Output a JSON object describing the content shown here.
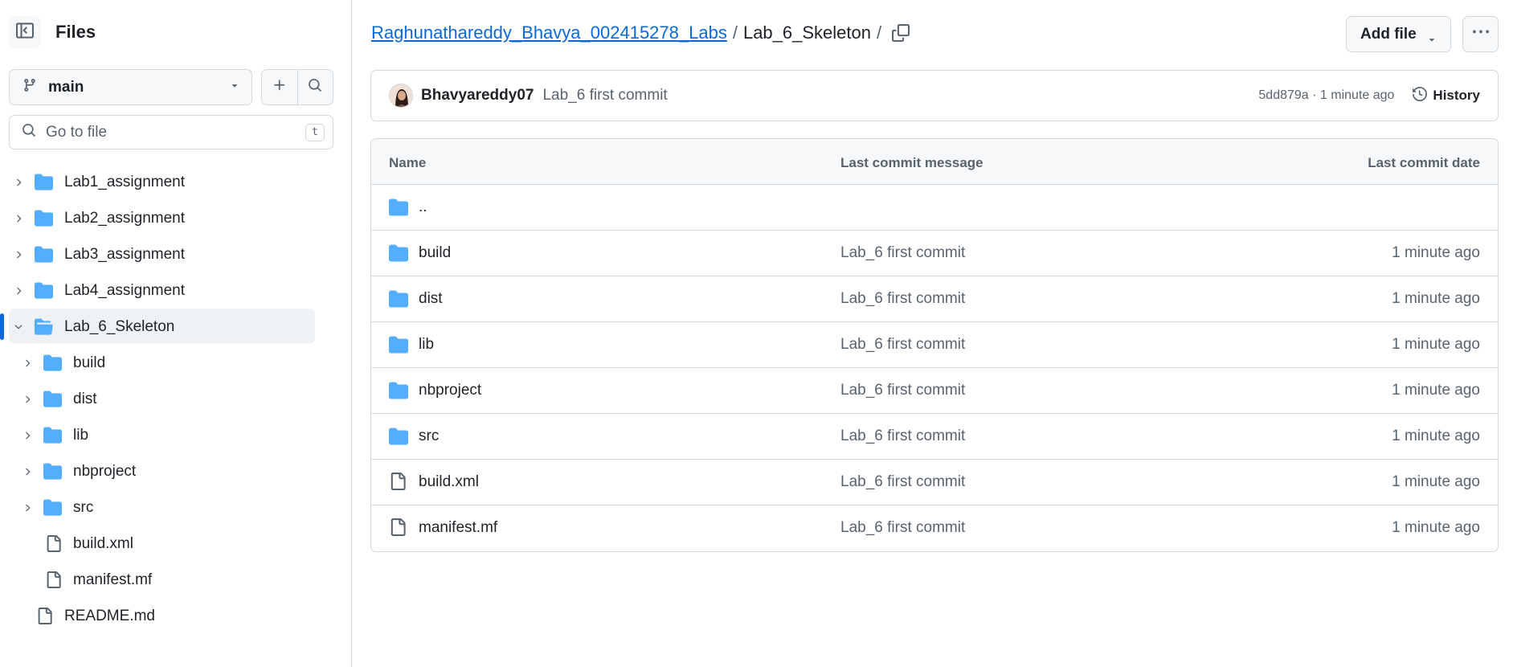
{
  "sidebar": {
    "title": "Files",
    "branch": "main",
    "goto_placeholder": "Go to file",
    "goto_shortcut": "t",
    "tree": [
      {
        "label": "Lab1_assignment",
        "type": "folder",
        "depth": 0,
        "expanded": false
      },
      {
        "label": "Lab2_assignment",
        "type": "folder",
        "depth": 0,
        "expanded": false
      },
      {
        "label": "Lab3_assignment",
        "type": "folder",
        "depth": 0,
        "expanded": false
      },
      {
        "label": "Lab4_assignment",
        "type": "folder",
        "depth": 0,
        "expanded": false
      },
      {
        "label": "Lab_6_Skeleton",
        "type": "folder",
        "depth": 0,
        "expanded": true,
        "selected": true
      },
      {
        "label": "build",
        "type": "folder",
        "depth": 1,
        "expanded": false
      },
      {
        "label": "dist",
        "type": "folder",
        "depth": 1,
        "expanded": false
      },
      {
        "label": "lib",
        "type": "folder",
        "depth": 1,
        "expanded": false
      },
      {
        "label": "nbproject",
        "type": "folder",
        "depth": 1,
        "expanded": false
      },
      {
        "label": "src",
        "type": "folder",
        "depth": 1,
        "expanded": false
      },
      {
        "label": "build.xml",
        "type": "file",
        "depth": 1
      },
      {
        "label": "manifest.mf",
        "type": "file",
        "depth": 1
      },
      {
        "label": "README.md",
        "type": "file",
        "depth": 0
      }
    ]
  },
  "breadcrumb": {
    "repo": "Raghunathareddy_Bhavya_002415278_Labs",
    "separator": "/",
    "current": "Lab_6_Skeleton",
    "trailing": "/"
  },
  "actions": {
    "add_file_label": "Add file"
  },
  "commit": {
    "author": "Bhavyareddy07",
    "message": "Lab_6 first commit",
    "meta": "5dd879a · 1 minute ago",
    "history_label": "History"
  },
  "table": {
    "headers": {
      "name": "Name",
      "message": "Last commit message",
      "date": "Last commit date"
    },
    "parent_label": "..",
    "rows": [
      {
        "name": "build",
        "type": "folder",
        "message": "Lab_6 first commit",
        "date": "1 minute ago"
      },
      {
        "name": "dist",
        "type": "folder",
        "message": "Lab_6 first commit",
        "date": "1 minute ago"
      },
      {
        "name": "lib",
        "type": "folder",
        "message": "Lab_6 first commit",
        "date": "1 minute ago"
      },
      {
        "name": "nbproject",
        "type": "folder",
        "message": "Lab_6 first commit",
        "date": "1 minute ago"
      },
      {
        "name": "src",
        "type": "folder",
        "message": "Lab_6 first commit",
        "date": "1 minute ago"
      },
      {
        "name": "build.xml",
        "type": "file",
        "message": "Lab_6 first commit",
        "date": "1 minute ago"
      },
      {
        "name": "manifest.mf",
        "type": "file",
        "message": "Lab_6 first commit",
        "date": "1 minute ago"
      }
    ]
  },
  "colors": {
    "folder": "#54aeff",
    "link": "#0969da",
    "muted": "#59636e",
    "border": "#d1d9e0"
  }
}
